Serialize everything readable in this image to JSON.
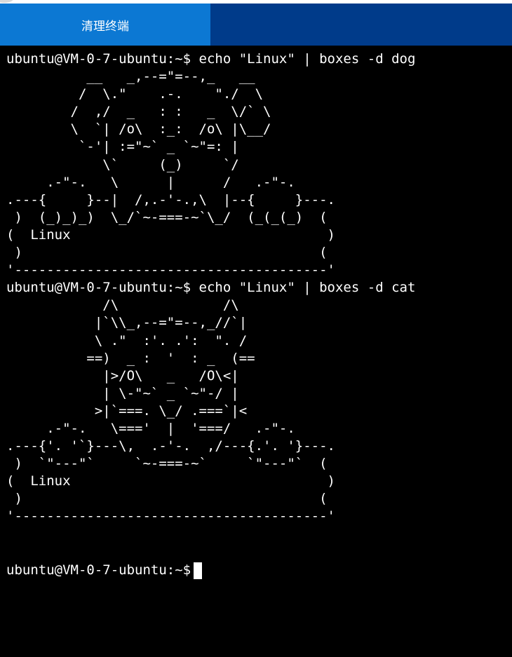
{
  "toolbar": {
    "clear_terminal_label": "清理终端"
  },
  "colors": {
    "toolbar_background": "#003b8a",
    "tab_background": "#0c78d3",
    "terminal_background": "#000000",
    "terminal_text": "#ffffff"
  },
  "terminal": {
    "output": "ubuntu@VM-0-7-ubuntu:~$ echo \"Linux\" | boxes -d dog\n          __   _,--=\"=--,_   __\n         /  \\.\"    .-.    \"./  \\\n        /  ,/  _   : :   _  \\/` \\\n        \\  `| /o\\  :_:  /o\\ |\\__/\n         `-'| :=\"~` _ `~\"=: |\n            \\`     (_)     `/\n     .-\"-.   \\      |      /   .-\"-.\n.---{     }--|  /,.-'-.,\\  |--{     }---.\n )  (_)_)_)  \\_/`~-===-~`\\_/  (_(_(_)  (\n(  Linux                                )\n )                                     (\n'---------------------------------------'\nubuntu@VM-0-7-ubuntu:~$ echo \"Linux\" | boxes -d cat\n            /\\             /\\\n           |`\\\\_,--=\"=--,_//`|\n           \\ .\"  :'. .':  \". /\n          ==)  _ :  '  : _  (==\n            |>/O\\   _   /O\\<|\n            | \\-\"~` _ `~\"-/ |\n           >|`===. \\_/ .===`|<\n     .-\"-.   \\==='  |  '===/   .-\"-.\n.---{'. '`}---\\,  .-'-.  ,/---{.'. '}---.\n )  `\"---\"`     `~-===-~`     `\"---\"`  (\n(  Linux                                )\n )                                     (\n'---------------------------------------'",
    "prompt": "ubuntu@VM-0-7-ubuntu:~$"
  }
}
